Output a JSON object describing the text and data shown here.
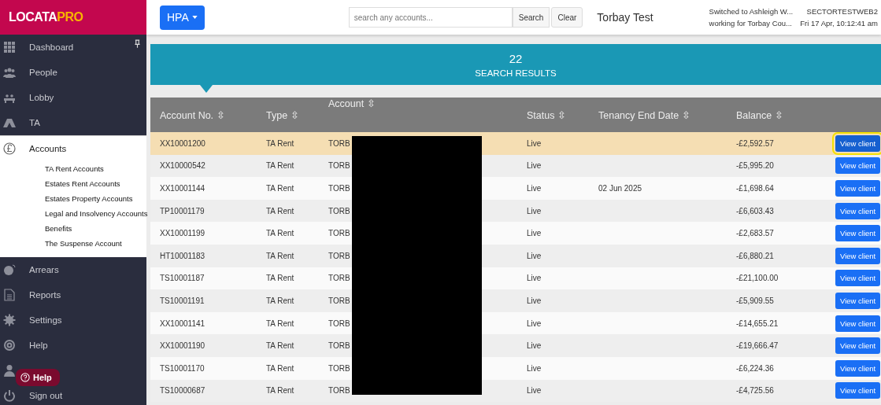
{
  "brand": {
    "logo_left": "LOCATA",
    "logo_right": "PRO"
  },
  "header": {
    "org_button": "HPA",
    "search": {
      "placeholder": "search any accounts..."
    },
    "search_button": "Search",
    "clear_button": "Clear",
    "site": "Torbay Test",
    "user_line1": "Switched to Ashleigh W...",
    "user_line2": "working for Torbay Cou...",
    "server": "SECTORTESTWEB2",
    "datetime": "Fri 17 Apr, 10:12:41 am"
  },
  "sidebar": {
    "items": [
      {
        "kind": "grid",
        "label": "Dashboard",
        "selected": false,
        "pinned": true
      },
      {
        "kind": "people",
        "label": "People",
        "selected": false
      },
      {
        "kind": "lobby",
        "label": "Lobby",
        "selected": false
      },
      {
        "kind": "tent",
        "label": "TA",
        "selected": false
      },
      {
        "kind": "pound",
        "label": "Accounts",
        "selected": true,
        "children": [
          {
            "label": "TA Rent Accounts"
          },
          {
            "label": "Estates Rent Accounts"
          },
          {
            "label": "Estates Property Accounts"
          },
          {
            "label": "Legal and Insolvency Accounts"
          },
          {
            "label": "Benefits"
          },
          {
            "label": "The Suspense Account"
          }
        ]
      },
      {
        "kind": "arrears",
        "label": "Arrears",
        "selected": false
      },
      {
        "kind": "doc",
        "label": "Reports",
        "selected": false
      },
      {
        "kind": "gear",
        "label": "Settings",
        "selected": false
      },
      {
        "kind": "lifebuoy",
        "label": "Help",
        "selected": false
      },
      {
        "kind": "person",
        "selected": false
      },
      {
        "kind": "power",
        "label": "Sign out",
        "selected": false
      }
    ]
  },
  "help_badge": "Help",
  "results": {
    "count": "22",
    "label": "SEARCH RESULTS"
  },
  "table": {
    "columns": [
      "Account No. ⇳",
      "Type ⇳",
      "Account ⇳",
      "Status ⇳",
      "Tenancy End Date ⇳",
      "Balance ⇳"
    ],
    "rows": [
      {
        "account_no": "XX10001200",
        "type": "TA Rent",
        "account": "TORB",
        "status": "Live",
        "end_date": "",
        "balance": "-£2,592.57",
        "action": "View client",
        "selected": true
      },
      {
        "account_no": "XX10000542",
        "type": "TA Rent",
        "account": "TORB",
        "status": "Live",
        "end_date": "",
        "balance": "-£5,995.20",
        "action": "View client",
        "selected": false
      },
      {
        "account_no": "XX10001144",
        "type": "TA Rent",
        "account": "TORB",
        "status": "Live",
        "end_date": "02 Jun 2025",
        "balance": "-£1,698.64",
        "action": "View client",
        "selected": false
      },
      {
        "account_no": "TP10001179",
        "type": "TA Rent",
        "account": "TORB",
        "status": "Live",
        "end_date": "",
        "balance": "-£6,603.43",
        "action": "View client",
        "selected": false
      },
      {
        "account_no": "XX10001199",
        "type": "TA Rent",
        "account": "TORB",
        "status": "Live",
        "end_date": "",
        "balance": "-£2,683.57",
        "action": "View client",
        "selected": false
      },
      {
        "account_no": "HT10001183",
        "type": "TA Rent",
        "account": "TORB",
        "status": "Live",
        "end_date": "",
        "balance": "-£6,880.21",
        "action": "View client",
        "selected": false
      },
      {
        "account_no": "TS10001187",
        "type": "TA Rent",
        "account": "TORB",
        "status": "Live",
        "end_date": "",
        "balance": "-£21,100.00",
        "action": "View client",
        "selected": false
      },
      {
        "account_no": "TS10001191",
        "type": "TA Rent",
        "account": "TORB",
        "status": "Live",
        "end_date": "",
        "balance": "-£5,909.55",
        "action": "View client",
        "selected": false
      },
      {
        "account_no": "XX10001141",
        "type": "TA Rent",
        "account": "TORB",
        "status": "Live",
        "end_date": "",
        "balance": "-£14,655.21",
        "action": "View client",
        "selected": false
      },
      {
        "account_no": "XX10001190",
        "type": "TA Rent",
        "account": "TORB",
        "status": "Live",
        "end_date": "",
        "balance": "-£19,666.47",
        "action": "View client",
        "selected": false
      },
      {
        "account_no": "TS10001170",
        "type": "TA Rent",
        "account": "TORB",
        "status": "Live",
        "end_date": "",
        "balance": "-£6,224.36",
        "action": "View client",
        "selected": false
      },
      {
        "account_no": "TS10000687",
        "type": "TA Rent",
        "account": "TORB",
        "status": "Live",
        "end_date": "",
        "balance": "-£4,725.56",
        "action": "View client",
        "selected": false
      }
    ]
  }
}
